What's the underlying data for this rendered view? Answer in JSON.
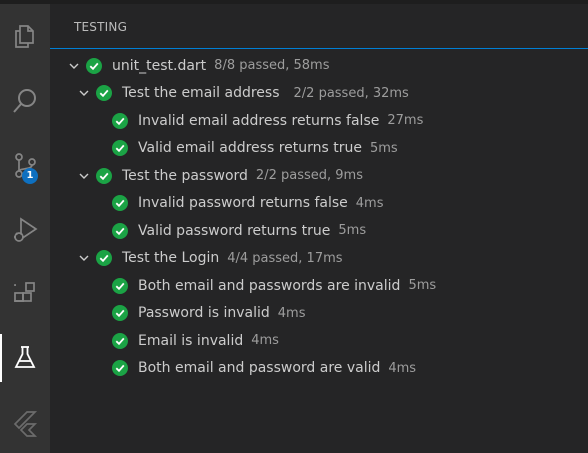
{
  "sidebar": {
    "title": "TESTING"
  },
  "activity_bar": {
    "items": [
      {
        "name": "explorer",
        "icon": "files-icon"
      },
      {
        "name": "search",
        "icon": "search-icon"
      },
      {
        "name": "source-control",
        "icon": "source-control-icon",
        "badge": "1"
      },
      {
        "name": "run-and-debug",
        "icon": "run-debug-icon"
      },
      {
        "name": "extensions",
        "icon": "extensions-icon"
      },
      {
        "name": "testing",
        "icon": "flask-icon",
        "active": true
      },
      {
        "name": "flutter",
        "icon": "flutter-icon"
      }
    ]
  },
  "tests": {
    "file": {
      "label": "unit_test.dart",
      "status": "8/8 passed, 58ms"
    },
    "groups": [
      {
        "label": "Test the email address",
        "status": "2/2 passed, 32ms",
        "tests": [
          {
            "label": "Invalid email address returns false",
            "time": "27ms"
          },
          {
            "label": "Valid email address returns true",
            "time": "5ms"
          }
        ]
      },
      {
        "label": "Test the password",
        "status": "2/2 passed, 9ms",
        "tests": [
          {
            "label": "Invalid password returns false",
            "time": "4ms"
          },
          {
            "label": "Valid password returns true",
            "time": "5ms"
          }
        ]
      },
      {
        "label": "Test the Login",
        "status": "4/4 passed, 17ms",
        "tests": [
          {
            "label": "Both email and passwords are invalid",
            "time": "5ms"
          },
          {
            "label": "Password is invalid",
            "time": "4ms"
          },
          {
            "label": "Email is invalid",
            "time": "4ms"
          },
          {
            "label": "Both email and password are valid",
            "time": "4ms"
          }
        ]
      }
    ]
  },
  "colors": {
    "pass": "#1ba345",
    "active_border": "#007fd4",
    "badge": "#0e70c0"
  }
}
